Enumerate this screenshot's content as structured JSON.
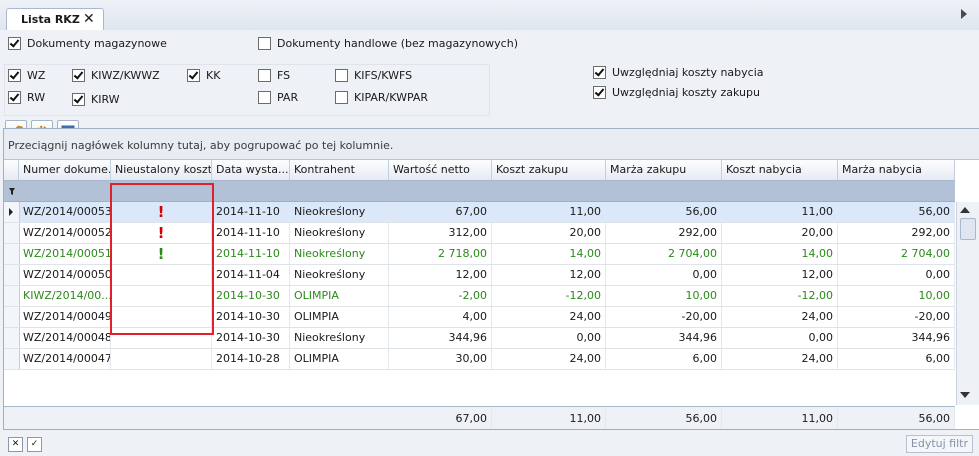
{
  "tab": {
    "title": "Lista RKZ",
    "close": "✕"
  },
  "filters": {
    "top": [
      {
        "label": "Dokumenty magazynowe",
        "checked": true
      },
      {
        "label": "Dokumenty handlowe (bez magazynowych)",
        "checked": false
      }
    ],
    "doc_types": [
      {
        "label": "WZ",
        "checked": true
      },
      {
        "label": "KIWZ/KWWZ",
        "checked": true
      },
      {
        "label": "KK",
        "checked": true
      },
      {
        "label": "FS",
        "checked": false
      },
      {
        "label": "KIFS/KWFS",
        "checked": false
      },
      {
        "label": "RW",
        "checked": true
      },
      {
        "label": "KIRW",
        "checked": true
      },
      {
        "label": "PAR",
        "checked": false
      },
      {
        "label": "KIPAR/KWPAR",
        "checked": false
      }
    ],
    "costs": [
      {
        "label": "Uwzględniaj koszty nabycia",
        "checked": true
      },
      {
        "label": "Uwzględniaj koszty zakupu",
        "checked": true
      }
    ]
  },
  "toolbar": {
    "icons": [
      "wrench-icon",
      "gear-doc-icon",
      "window-refresh-icon"
    ]
  },
  "grid": {
    "group_hint": "Przeciągnij nagłówek kolumny tutaj, aby pogrupować po tej kolumnie.",
    "columns": [
      "Numer dokume...",
      "Nieustalony koszt",
      "Data wysta...",
      "Kontrahent",
      "Wartość netto",
      "Koszt zakupu",
      "Marża zakupu",
      "Koszt nabycia",
      "Marża nabycia"
    ],
    "rows": [
      {
        "numer": "WZ/2014/00053",
        "flag": "!",
        "data": "2014-11-10",
        "kontrahent": "Nieokreślony",
        "netto": "67,00",
        "koszt_zakupu": "11,00",
        "marza_zakupu": "56,00",
        "koszt_nabycia": "11,00",
        "marza_nabycia": "56,00",
        "green": false,
        "selected": true
      },
      {
        "numer": "WZ/2014/00052",
        "flag": "!",
        "data": "2014-11-10",
        "kontrahent": "Nieokreślony",
        "netto": "312,00",
        "koszt_zakupu": "20,00",
        "marza_zakupu": "292,00",
        "koszt_nabycia": "20,00",
        "marza_nabycia": "292,00",
        "green": false,
        "selected": false
      },
      {
        "numer": "WZ/2014/00051",
        "flag": "!",
        "data": "2014-11-10",
        "kontrahent": "Nieokreślony",
        "netto": "2 718,00",
        "koszt_zakupu": "14,00",
        "marza_zakupu": "2 704,00",
        "koszt_nabycia": "14,00",
        "marza_nabycia": "2 704,00",
        "green": true,
        "selected": false
      },
      {
        "numer": "WZ/2014/00050",
        "flag": "",
        "data": "2014-11-04",
        "kontrahent": "Nieokreślony",
        "netto": "12,00",
        "koszt_zakupu": "12,00",
        "marza_zakupu": "0,00",
        "koszt_nabycia": "12,00",
        "marza_nabycia": "0,00",
        "green": false,
        "selected": false
      },
      {
        "numer": "KIWZ/2014/00...",
        "flag": "",
        "data": "2014-10-30",
        "kontrahent": "OLIMPIA",
        "netto": "-2,00",
        "koszt_zakupu": "-12,00",
        "marza_zakupu": "10,00",
        "koszt_nabycia": "-12,00",
        "marza_nabycia": "10,00",
        "green": true,
        "selected": false
      },
      {
        "numer": "WZ/2014/00049",
        "flag": "",
        "data": "2014-10-30",
        "kontrahent": "OLIMPIA",
        "netto": "4,00",
        "koszt_zakupu": "24,00",
        "marza_zakupu": "-20,00",
        "koszt_nabycia": "24,00",
        "marza_nabycia": "-20,00",
        "green": false,
        "selected": false
      },
      {
        "numer": "WZ/2014/00048",
        "flag": "",
        "data": "2014-10-30",
        "kontrahent": "Nieokreślony",
        "netto": "344,96",
        "koszt_zakupu": "0,00",
        "marza_zakupu": "344,96",
        "koszt_nabycia": "0,00",
        "marza_nabycia": "344,96",
        "green": false,
        "selected": false
      },
      {
        "numer": "WZ/2014/00047",
        "flag": "",
        "data": "2014-10-28",
        "kontrahent": "OLIMPIA",
        "netto": "30,00",
        "koszt_zakupu": "24,00",
        "marza_zakupu": "6,00",
        "koszt_nabycia": "24,00",
        "marza_nabycia": "6,00",
        "green": false,
        "selected": false
      }
    ],
    "totals": {
      "netto": "67,00",
      "koszt_zakupu": "11,00",
      "marza_zakupu": "56,00",
      "koszt_nabycia": "11,00",
      "marza_nabycia": "56,00"
    }
  },
  "bottom": {
    "edit_filter": "Edytuj filtr"
  },
  "colors": {
    "highlight": "#e0202a",
    "green_text": "#2a8a1a",
    "flag": "#d40000"
  }
}
